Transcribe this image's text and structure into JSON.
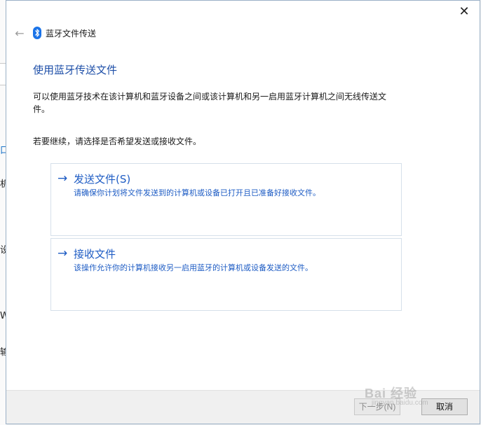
{
  "background_fragments": [
    "口",
    "机",
    "设",
    "W",
    "输"
  ],
  "dialog": {
    "title": "蓝牙文件传送",
    "close_glyph": "✕",
    "back_glyph": "←",
    "heading": "使用蓝牙传送文件",
    "description": "可以使用蓝牙技术在该计算机和蓝牙设备之间或该计算机和另一启用蓝牙计算机之间无线传送文件。",
    "prompt": "若要继续，请选择是否希望发送或接收文件。",
    "options": [
      {
        "arrow": "→",
        "title": "发送文件(S)",
        "description": "请确保你计划将文件发送到的计算机或设备已打开且已准备好接收文件。"
      },
      {
        "arrow": "→",
        "title": "接收文件",
        "description": "该操作允许你的计算机接收另一启用蓝牙的计算机或设备发送的文件。"
      }
    ],
    "buttons": {
      "next": "下一步(N)",
      "cancel": "取消"
    }
  },
  "watermark": {
    "main": "Bai 经验",
    "sub": "jingyan.baidu.com"
  },
  "colors": {
    "accent": "#1e5cc4",
    "bluetooth": "#1a73e8"
  },
  "icons": {
    "bluetooth": "bluetooth-icon",
    "back": "back-arrow-icon",
    "close": "close-icon",
    "option_arrow": "arrow-right-icon"
  }
}
